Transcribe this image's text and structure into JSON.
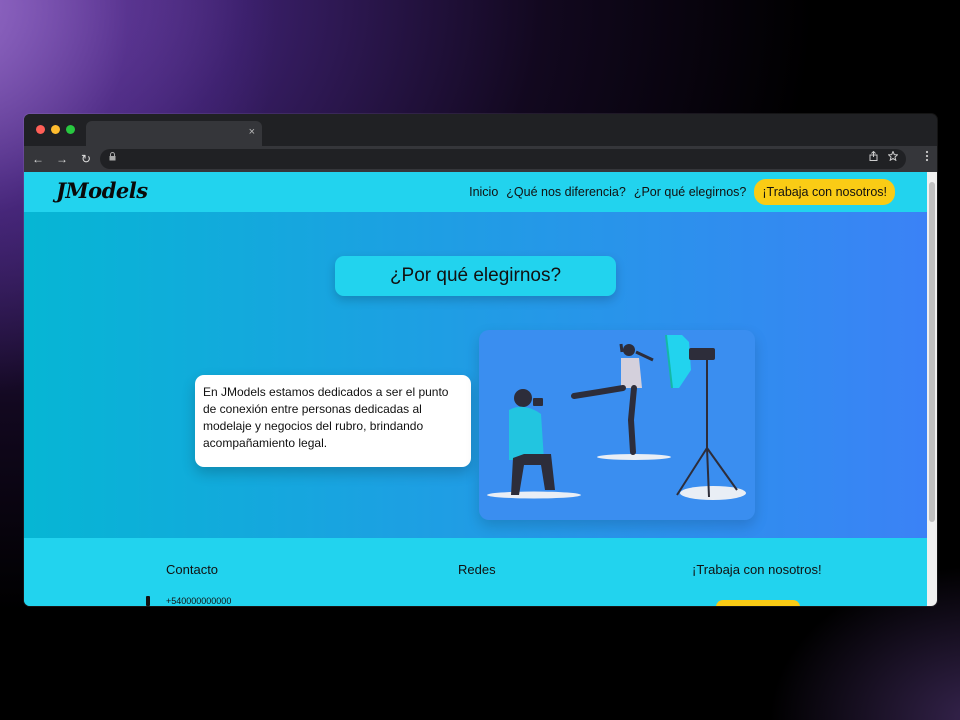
{
  "browser": {
    "tab_close": "×",
    "nav": {
      "back": "←",
      "forward": "→",
      "reload": "↻"
    }
  },
  "navbar": {
    "logo": "JModels",
    "links": [
      "Inicio",
      "¿Qué nos diferencia?",
      "¿Por qué elegirnos?"
    ],
    "cta": "¡Trabaja con nosotros!"
  },
  "hero": {
    "title": "¿Por qué elegirnos?",
    "description": "En JModels estamos dedicados a ser el punto de conexión entre personas dedicadas al modelaje y negocios del rubro, brindando acompañamiento legal."
  },
  "footer": {
    "contact_title": "Contacto",
    "social_title": "Redes",
    "work_title": "¡Trabaja con nosotros!",
    "phone": "+540000000000"
  },
  "colors": {
    "primary": "#22d3ee",
    "gradient_start": "#06b6d4",
    "gradient_end": "#3b82f6",
    "accent": "#facc15"
  }
}
